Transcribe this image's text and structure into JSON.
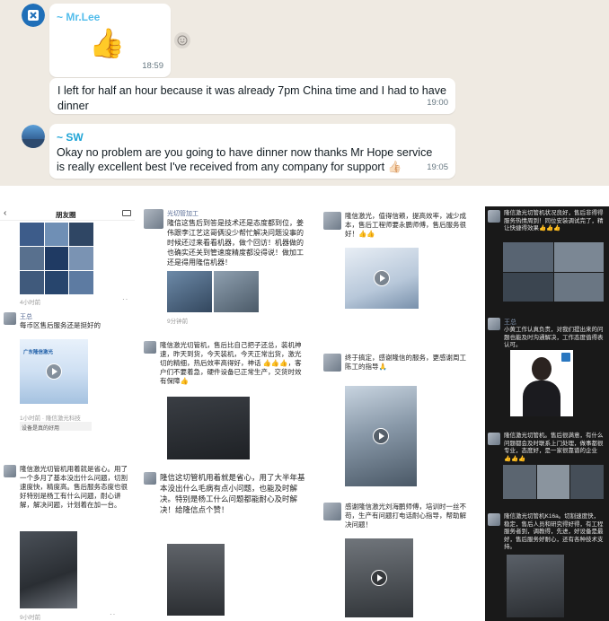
{
  "chat": {
    "msg1": {
      "sender": "~ Mr.Lee",
      "emoji": "👍",
      "time": "18:59"
    },
    "msg2": {
      "text": "I left for half an hour because it was already 7pm China time and I had to have dinner",
      "time": "19:00"
    },
    "msg3": {
      "sender": "~ SW",
      "text": "Okay no problem are you going to have dinner now thanks Mr Hope service is really excellent best I've received from any company for support",
      "emoji": "👍🏻",
      "time": "19:05"
    },
    "react_icon": "smiley-icon"
  },
  "moments": {
    "col1": {
      "header_title": "朋友圈",
      "back_icon": "chevron-left-icon",
      "camera_icon": "camera-icon",
      "p1_meta": "4小时前",
      "p2_name": "王总",
      "p2_text": "每币区售后服务还是挺好的",
      "p2_banner": "广东隆信激光",
      "p2_meta": "1小时前 · 隆信激光科技",
      "p2_footer": "设备是真的好用",
      "p3_text": "隆信激光切管机用着就是省心。用了一个多月了基本没出什么问题，切割速度快，精度高。售后服务态度也很好特别是杨工有什么问题，耐心讲解，解决问题，计划着在加一台。",
      "p3_meta": "9小时前"
    },
    "col2": {
      "p1_name": "光切管加工",
      "p1_text": "隆信这售后到答是技术还是态度都到位，姜伟跟李江艺这哥俩没少帮忙解决问题没事的时候还过来看看机器，做个回访！机器做的也确实还关到管速度精度都没得说！做加工还是得用隆信机器！",
      "p1_meta": "9分钟前",
      "p2_text": "隆信激光切管机，售后比自己把子还总，装机神速，昨天到货，今天装机，今天正常出货，激光切的精细，热后效率高得好，神话 👍👍👍，客户们不要着急，硬件设备已正常生产，交货时效有保障👍",
      "p3_text": "隆信这切管机用着就是省心，用了大半年基本没出什么毛病有点小问题，也能及时解决。特别是杨工什么问题都能耐心及时解决！给隆信点个赞！"
    },
    "col3": {
      "p1_text": "隆信激光，值得信赖，提高效率，减少成本，售后工程师要永鹏师傅，售后服务很好！👍👍",
      "p2_text": "终于搞定，感谢隆信的服务，更感谢周工陈工的指导🙏",
      "p3_text": "感谢隆信激光刘海鹏师傅，培训时一丝不苟，生产有问题打电话耐心指导，帮助解决问题！"
    },
    "col4": {
      "p1_text": "隆信激光切管机状况良好，售后非得得服务热情周到！同位安装调试完了，精让快捷得效果👍👍👍",
      "p2_name": "王总",
      "p2_text": "小黄工作认真负责，对我们提出来的问题也能及时沟通解决，工作态度值得表认可。",
      "p3_text": "隆信激光切管机。售后很满意，有什么问题都会及时联系上门处理，做事都很专业，态度好，是一家很靠谱的企业👍👍👍",
      "p4_text": "隆信激光切管机K16a。切割速度快，稳定，售后人员和研究得好得，有工程服务者到，调教得，先进，好设备是最好，售后服务好耐心，还有各种技术支持。"
    }
  },
  "colors": {
    "chat_bg": "#efeae2",
    "bubble": "#ffffff",
    "sender_color": "#53bdeb",
    "timestamp": "#667781",
    "dark_panel": "#191919"
  }
}
